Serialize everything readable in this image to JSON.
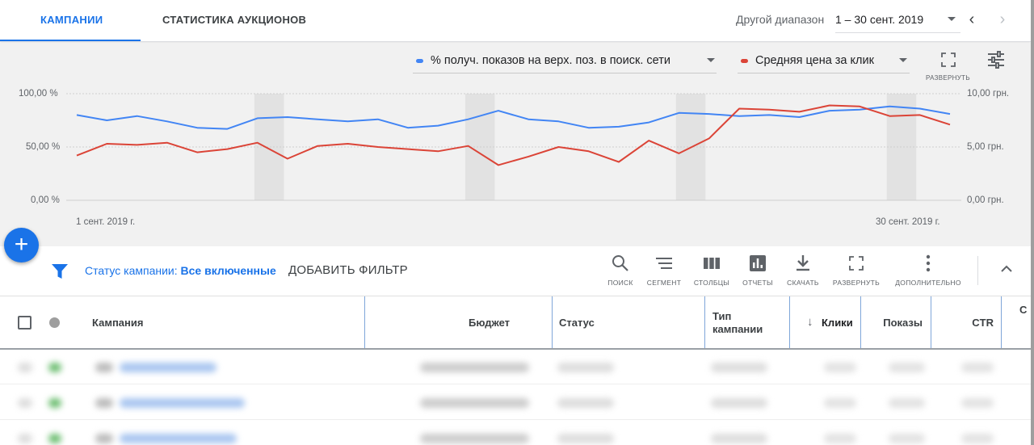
{
  "tabs": [
    {
      "label": "КАМПАНИИ",
      "active": true
    },
    {
      "label": "СТАТИСТИКА АУКЦИОНОВ",
      "active": false
    }
  ],
  "date_range": {
    "label": "Другой диапазон",
    "value": "1 – 30 сент. 2019"
  },
  "metrics": [
    {
      "label": "% получ. показов на верх. поз. в поиск. сети",
      "color": "#4285f4"
    },
    {
      "label": "Средняя цена за клик",
      "color": "#db4437"
    }
  ],
  "chart_toolbar": {
    "expand_label": "РАЗВЕРНУТЬ"
  },
  "chart_data": {
    "type": "line",
    "x": [
      "1 сент. 2019 г.",
      "2",
      "3",
      "4",
      "5",
      "6",
      "7",
      "8",
      "9",
      "10",
      "11",
      "12",
      "13",
      "14",
      "15",
      "16",
      "17",
      "18",
      "19",
      "20",
      "21",
      "22",
      "23",
      "24",
      "25",
      "26",
      "27",
      "28",
      "29",
      "30 сент. 2019 г."
    ],
    "x_tick_labels": [
      "1 сент. 2019 г.",
      "30 сент. 2019 г."
    ],
    "series": [
      {
        "name": "% получ. показов на верх. поз. в поиск. сети",
        "axis": "left",
        "color": "#4285f4",
        "values": [
          80,
          75,
          79,
          74,
          68,
          67,
          77,
          78,
          76,
          74,
          76,
          68,
          70,
          76,
          84,
          76,
          74,
          68,
          69,
          73,
          82,
          81,
          79,
          80,
          78,
          84,
          85,
          88,
          86,
          81
        ]
      },
      {
        "name": "Средняя цена за клик",
        "axis": "right",
        "color": "#db4437",
        "values": [
          4.2,
          5.3,
          5.2,
          5.4,
          4.5,
          4.8,
          5.4,
          3.9,
          5.1,
          5.3,
          5.0,
          4.8,
          4.6,
          5.1,
          3.3,
          4.1,
          5.0,
          4.6,
          3.6,
          5.6,
          4.4,
          5.8,
          8.6,
          8.5,
          8.3,
          8.9,
          8.8,
          7.9,
          8.0,
          7.1
        ]
      }
    ],
    "y_left": {
      "ticks": [
        "0,00 %",
        "50,00 %",
        "100,00 %"
      ],
      "range": [
        0,
        100
      ]
    },
    "y_right": {
      "ticks": [
        "0,00 грн.",
        "5,00 грн.",
        "10,00 грн."
      ],
      "range": [
        0,
        10
      ]
    },
    "weekend_day_indexes": [
      6,
      13,
      20,
      27
    ]
  },
  "filter": {
    "prefix": "Статус кампании:",
    "value": "Все включенные",
    "add_label": "ДОБАВИТЬ ФИЛЬТР"
  },
  "tools": [
    {
      "label": "ПОИСК",
      "icon": "search-icon"
    },
    {
      "label": "СЕГМЕНТ",
      "icon": "segment-icon"
    },
    {
      "label": "СТОЛБЦЫ",
      "icon": "columns-icon"
    },
    {
      "label": "ОТЧЕТЫ",
      "icon": "reports-icon"
    },
    {
      "label": "СКАЧАТЬ",
      "icon": "download-icon"
    },
    {
      "label": "РАЗВЕРНУТЬ",
      "icon": "expand-icon"
    },
    {
      "label": "ДОПОЛНИТЕЛЬНО",
      "icon": "more-vert-icon"
    }
  ],
  "table": {
    "columns": {
      "campaign": "Кампания",
      "budget": "Бюджет",
      "status": "Статус",
      "type_line1": "Тип",
      "type_line2": "кампании",
      "clicks": "Клики",
      "impressions": "Показы",
      "ctr": "CTR",
      "next_partial": "С"
    }
  }
}
